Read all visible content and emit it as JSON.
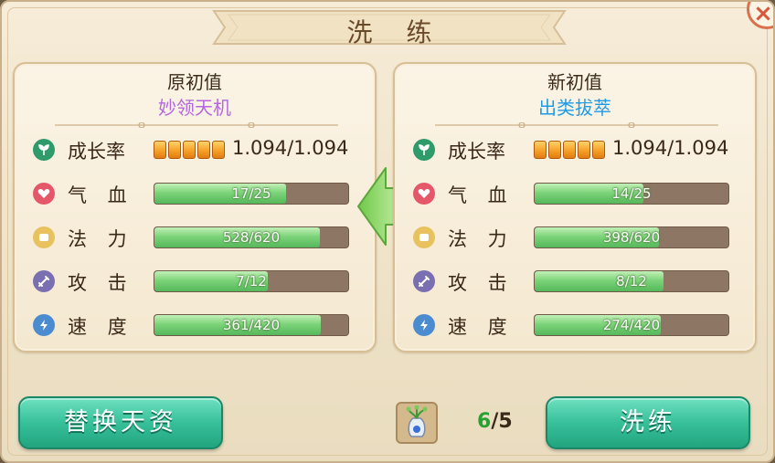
{
  "title": "洗 练",
  "close_label": "×",
  "left_panel": {
    "heading": "原初值",
    "trait": "妙领天机",
    "growth": {
      "label": "成长率",
      "value": "1.094/1.094",
      "pips": 5
    },
    "stats": [
      {
        "key": "hp",
        "label": "气 血",
        "text": "17/25",
        "current": 17,
        "max": 25,
        "icon": "heart-icon"
      },
      {
        "key": "mp",
        "label": "法 力",
        "text": "528/620",
        "current": 528,
        "max": 620,
        "icon": "scroll-icon"
      },
      {
        "key": "atk",
        "label": "攻 击",
        "text": "7/12",
        "current": 7,
        "max": 12,
        "icon": "sword-icon"
      },
      {
        "key": "spd",
        "label": "速 度",
        "text": "361/420",
        "current": 361,
        "max": 420,
        "icon": "lightning-icon"
      }
    ]
  },
  "right_panel": {
    "heading": "新初值",
    "trait": "出类拔萃",
    "growth": {
      "label": "成长率",
      "value": "1.094/1.094",
      "pips": 5
    },
    "stats": [
      {
        "key": "hp",
        "label": "气 血",
        "text": "14/25",
        "current": 14,
        "max": 25,
        "icon": "heart-icon"
      },
      {
        "key": "mp",
        "label": "法 力",
        "text": "398/620",
        "current": 398,
        "max": 620,
        "icon": "scroll-icon"
      },
      {
        "key": "atk",
        "label": "攻 击",
        "text": "8/12",
        "current": 8,
        "max": 12,
        "icon": "sword-icon"
      },
      {
        "key": "spd",
        "label": "速 度",
        "text": "274/420",
        "current": 274,
        "max": 420,
        "icon": "lightning-icon"
      }
    ]
  },
  "buttons": {
    "replace": "替换天资",
    "refine": "洗练"
  },
  "item": {
    "icon": "potion-vase-icon",
    "current": "6",
    "separator": "/",
    "required": "5"
  },
  "colors": {
    "accent_green": "#37c09a",
    "bar_fill": "#7dd47a",
    "bar_track": "#8d7663",
    "trait_left": "#b566e0",
    "trait_right": "#1f9be6",
    "counter_ok": "#29a033",
    "close": "#d8563a"
  }
}
